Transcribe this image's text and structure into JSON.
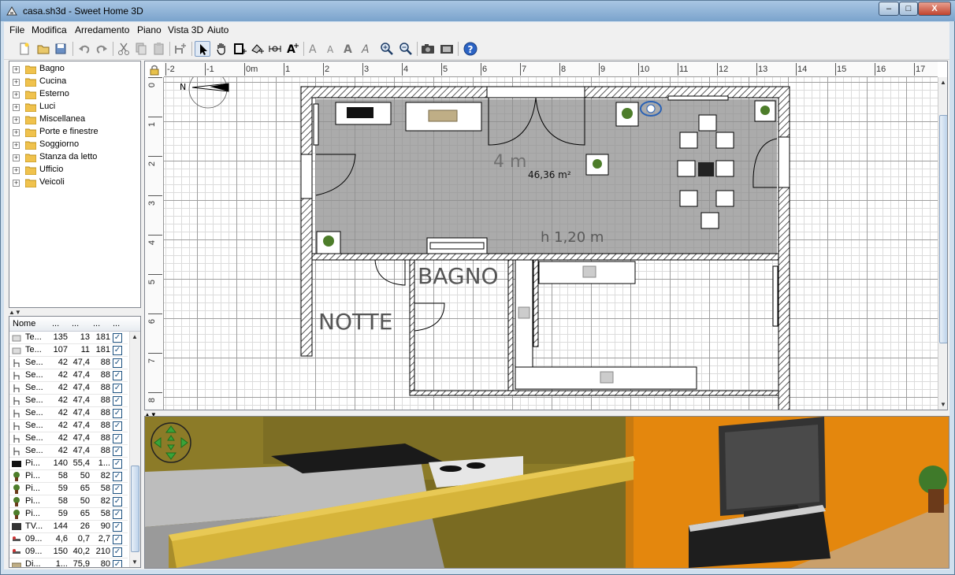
{
  "window": {
    "title": "casa.sh3d - Sweet Home 3D",
    "buttons": {
      "minimize": "–",
      "maximize": "□",
      "close": "X"
    }
  },
  "menu": [
    {
      "label": "File"
    },
    {
      "label": "Modifica"
    },
    {
      "label": "Arredamento"
    },
    {
      "label": "Piano"
    },
    {
      "label": "Vista 3D"
    },
    {
      "label": "Aiuto"
    }
  ],
  "toolbar": {
    "icons": [
      "new-icon",
      "open-icon",
      "save-icon",
      "undo-icon",
      "redo-icon",
      "cut-icon",
      "copy-icon",
      "paste-icon",
      "add-furniture-icon",
      "select-icon",
      "pan-icon",
      "create-walls-icon",
      "create-rooms-icon",
      "create-dimensions-icon",
      "add-text-icon",
      "text-style-1-icon",
      "text-style-2-icon",
      "text-bold-icon",
      "text-italic-icon",
      "zoom-in-icon",
      "zoom-out-icon",
      "photo-icon",
      "video-icon",
      "help-icon"
    ],
    "active": "select-icon"
  },
  "catalog": {
    "categories": [
      "Bagno",
      "Cucina",
      "Esterno",
      "Luci",
      "Miscellanea",
      "Porte e finestre",
      "Soggiorno",
      "Stanza da letto",
      "Ufficio",
      "Veicoli"
    ]
  },
  "furniture_table": {
    "headers": [
      "Nome",
      "...",
      "...",
      "...",
      "..."
    ],
    "rows": [
      {
        "icon": "table-icon",
        "name": "Te...",
        "w": "135",
        "d": "13",
        "h": "181",
        "visible": true
      },
      {
        "icon": "table-icon",
        "name": "Te...",
        "w": "107",
        "d": "11",
        "h": "181",
        "visible": true
      },
      {
        "icon": "chair-icon",
        "name": "Se...",
        "w": "42",
        "d": "47,4",
        "h": "88",
        "visible": true
      },
      {
        "icon": "chair-icon",
        "name": "Se...",
        "w": "42",
        "d": "47,4",
        "h": "88",
        "visible": true
      },
      {
        "icon": "chair-icon",
        "name": "Se...",
        "w": "42",
        "d": "47,4",
        "h": "88",
        "visible": true
      },
      {
        "icon": "chair-icon",
        "name": "Se...",
        "w": "42",
        "d": "47,4",
        "h": "88",
        "visible": true
      },
      {
        "icon": "chair-icon",
        "name": "Se...",
        "w": "42",
        "d": "47,4",
        "h": "88",
        "visible": true
      },
      {
        "icon": "chair-icon",
        "name": "Se...",
        "w": "42",
        "d": "47,4",
        "h": "88",
        "visible": true
      },
      {
        "icon": "chair-icon",
        "name": "Se...",
        "w": "42",
        "d": "47,4",
        "h": "88",
        "visible": true
      },
      {
        "icon": "chair-icon",
        "name": "Se...",
        "w": "42",
        "d": "47,4",
        "h": "88",
        "visible": true
      },
      {
        "icon": "piano-icon",
        "name": "Pi...",
        "w": "140",
        "d": "55,4",
        "h": "1...",
        "visible": true
      },
      {
        "icon": "plant-icon",
        "name": "Pi...",
        "w": "58",
        "d": "50",
        "h": "82",
        "visible": true
      },
      {
        "icon": "plant-icon",
        "name": "Pi...",
        "w": "59",
        "d": "65",
        "h": "58",
        "visible": true
      },
      {
        "icon": "plant-icon",
        "name": "Pi...",
        "w": "58",
        "d": "50",
        "h": "82",
        "visible": true
      },
      {
        "icon": "plant-icon",
        "name": "Pi...",
        "w": "59",
        "d": "65",
        "h": "58",
        "visible": true
      },
      {
        "icon": "tv-icon",
        "name": "TV...",
        "w": "144",
        "d": "26",
        "h": "90",
        "visible": true
      },
      {
        "icon": "item-icon",
        "name": "09...",
        "w": "4,6",
        "d": "0,7",
        "h": "2,7",
        "visible": true
      },
      {
        "icon": "item-icon",
        "name": "09...",
        "w": "150",
        "d": "40,2",
        "h": "210",
        "visible": true
      },
      {
        "icon": "sofa-icon",
        "name": "Di...",
        "w": "1...",
        "d": "75,9",
        "h": "80",
        "visible": true
      }
    ]
  },
  "plan": {
    "ruler_top": [
      "-2",
      "-1",
      "0m",
      "1",
      "2",
      "3",
      "4",
      "5",
      "6",
      "7",
      "8",
      "9",
      "10",
      "11",
      "12",
      "13",
      "14",
      "15",
      "16",
      "17"
    ],
    "ruler_left": [
      "0",
      "1",
      "2",
      "3",
      "4",
      "5",
      "6",
      "7",
      "8"
    ],
    "compass_label": "N",
    "room_labels": {
      "dimension": "4 m",
      "area": "46,36 m²",
      "height": "h 1,20 m",
      "bagno": "BAGNO",
      "notte": "NOTTE"
    }
  },
  "view3d": {
    "navigator": "navigation-arrows-icon"
  }
}
